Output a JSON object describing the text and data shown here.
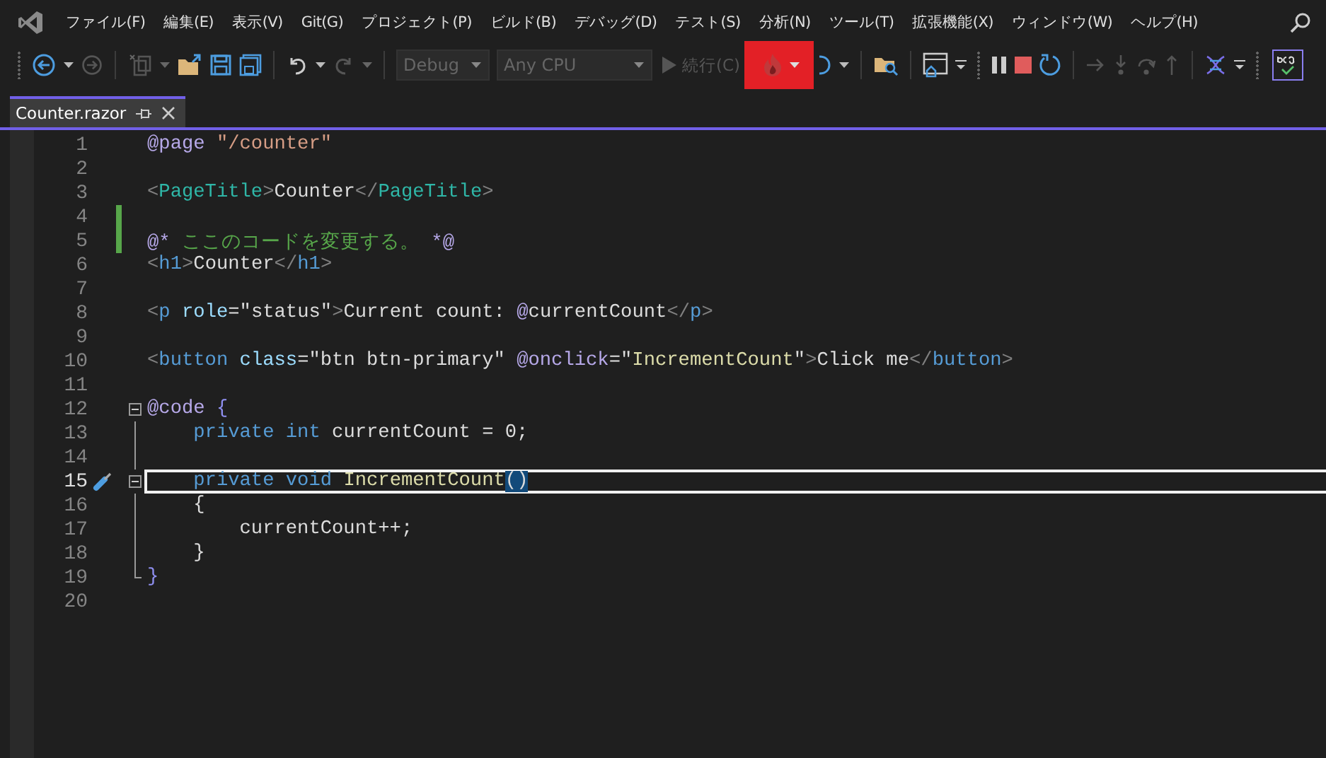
{
  "menu": [
    {
      "label": "ファイル(F)"
    },
    {
      "label": "編集(E)"
    },
    {
      "label": "表示(V)"
    },
    {
      "label": "Git(G)"
    },
    {
      "label": "プロジェクト(P)"
    },
    {
      "label": "ビルド(B)"
    },
    {
      "label": "デバッグ(D)"
    },
    {
      "label": "テスト(S)"
    },
    {
      "label": "分析(N)"
    },
    {
      "label": "ツール(T)"
    },
    {
      "label": "拡張機能(X)"
    },
    {
      "label": "ウィンドウ(W)"
    },
    {
      "label": "ヘルプ(H)"
    }
  ],
  "toolbar": {
    "configuration": {
      "value": "Debug",
      "disabled": true
    },
    "platform": {
      "value": "Any CPU",
      "disabled": true
    },
    "continue": {
      "label": "続行(C)",
      "disabled": true
    },
    "hot_reload": {
      "highlighted": true
    }
  },
  "tabs": [
    {
      "label": "Counter.razor",
      "selected": true
    }
  ],
  "editor": {
    "lines": [
      {
        "number": "1",
        "tokens": [
          {
            "text": "@page ",
            "kind": "razor"
          },
          {
            "text": "\"/counter\"",
            "kind": "string"
          }
        ]
      },
      {
        "number": "2"
      },
      {
        "number": "3",
        "tokens": [
          {
            "text": "<",
            "kind": "bracket"
          },
          {
            "text": "PageTitle",
            "kind": "component"
          },
          {
            "text": ">",
            "kind": "bracket"
          },
          {
            "text": "Counter",
            "kind": "plain"
          },
          {
            "text": "</",
            "kind": "bracket"
          },
          {
            "text": "PageTitle",
            "kind": "component"
          },
          {
            "text": ">",
            "kind": "bracket"
          }
        ]
      },
      {
        "number": "4",
        "changed": true
      },
      {
        "number": "5",
        "changed": true,
        "tokens": [
          {
            "text": "@*",
            "kind": "razor"
          },
          {
            "text": " ここのコードを変更する。 ",
            "kind": "comment"
          },
          {
            "text": "*@",
            "kind": "razor"
          }
        ]
      },
      {
        "number": "6",
        "tokens": [
          {
            "text": "<",
            "kind": "bracket"
          },
          {
            "text": "h1",
            "kind": "element"
          },
          {
            "text": ">",
            "kind": "bracket"
          },
          {
            "text": "Counter",
            "kind": "plain"
          },
          {
            "text": "</",
            "kind": "bracket"
          },
          {
            "text": "h1",
            "kind": "element"
          },
          {
            "text": ">",
            "kind": "bracket"
          }
        ]
      },
      {
        "number": "7"
      },
      {
        "number": "8",
        "tokens": [
          {
            "text": "<",
            "kind": "bracket"
          },
          {
            "text": "p",
            "kind": "element"
          },
          {
            "text": " role",
            "kind": "attr"
          },
          {
            "text": "=\"status\"",
            "kind": "plain"
          },
          {
            "text": ">",
            "kind": "bracket"
          },
          {
            "text": "Current count: ",
            "kind": "plain"
          },
          {
            "text": "@",
            "kind": "razor"
          },
          {
            "text": "currentCount",
            "kind": "plain"
          },
          {
            "text": "</",
            "kind": "bracket"
          },
          {
            "text": "p",
            "kind": "element"
          },
          {
            "text": ">",
            "kind": "bracket"
          }
        ]
      },
      {
        "number": "9"
      },
      {
        "number": "10",
        "tokens": [
          {
            "text": "<",
            "kind": "bracket"
          },
          {
            "text": "button",
            "kind": "element"
          },
          {
            "text": " class",
            "kind": "attr"
          },
          {
            "text": "=\"btn btn-primary\" ",
            "kind": "plain"
          },
          {
            "text": "@onclick",
            "kind": "razor"
          },
          {
            "text": "=\"",
            "kind": "plain"
          },
          {
            "text": "IncrementCount",
            "kind": "method"
          },
          {
            "text": "\"",
            "kind": "plain"
          },
          {
            "text": ">",
            "kind": "bracket"
          },
          {
            "text": "Click me",
            "kind": "plain"
          },
          {
            "text": "</",
            "kind": "bracket"
          },
          {
            "text": "button",
            "kind": "element"
          },
          {
            "text": ">",
            "kind": "bracket"
          }
        ]
      },
      {
        "number": "11"
      },
      {
        "number": "12",
        "fold_start": true,
        "tokens": [
          {
            "text": "@code ",
            "kind": "razor"
          },
          {
            "text": "{",
            "kind": "brace"
          }
        ]
      },
      {
        "number": "13",
        "fold_guide": true,
        "tokens": [
          {
            "text": "    private int ",
            "kind": "keyword"
          },
          {
            "text": "currentCount = 0;",
            "kind": "plain"
          }
        ]
      },
      {
        "number": "14",
        "fold_guide": true
      },
      {
        "number": "15",
        "fold_start": true,
        "current": true,
        "quick_action": true,
        "tokens": [
          {
            "text": "    private void ",
            "kind": "keyword"
          },
          {
            "text": "IncrementCount",
            "kind": "method"
          },
          {
            "text": "()",
            "kind": "match"
          }
        ]
      },
      {
        "number": "16",
        "fold_guide": true,
        "tokens": [
          {
            "text": "    {",
            "kind": "plain"
          }
        ]
      },
      {
        "number": "17",
        "fold_guide": true,
        "tokens": [
          {
            "text": "        currentCount++;",
            "kind": "plain"
          }
        ]
      },
      {
        "number": "18",
        "fold_guide": true,
        "tokens": [
          {
            "text": "    }",
            "kind": "plain"
          }
        ]
      },
      {
        "number": "19",
        "fold_end": true,
        "tokens": [
          {
            "text": "}",
            "kind": "brace"
          }
        ]
      },
      {
        "number": "20"
      }
    ]
  }
}
